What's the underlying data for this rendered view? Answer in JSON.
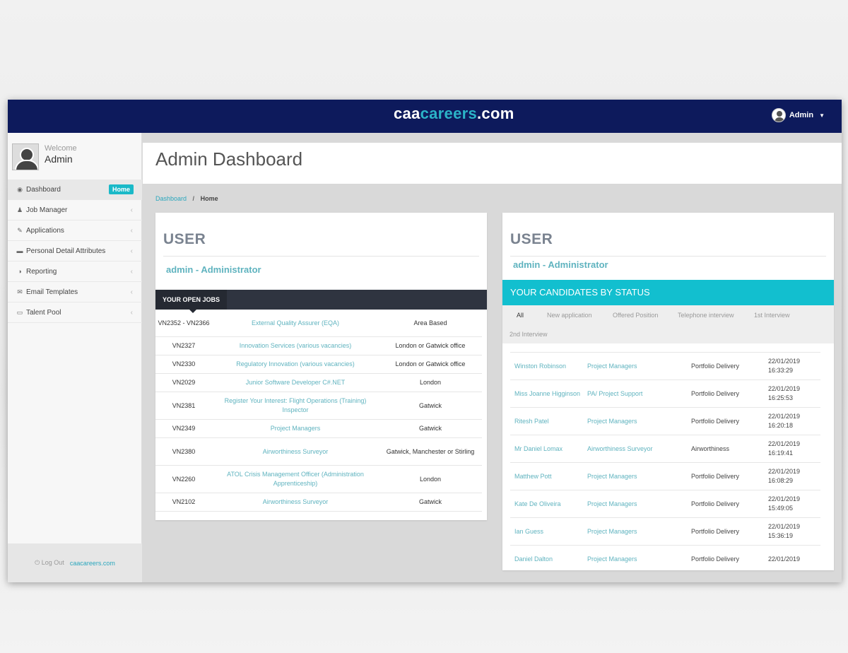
{
  "brand": {
    "prefix": "caa",
    "accent": "careers",
    "suffix": ".com"
  },
  "user_menu": {
    "name": "Admin"
  },
  "sidebar": {
    "welcome_label": "Welcome",
    "welcome_name": "Admin",
    "items": [
      {
        "label": "Dashboard",
        "icon": "dashboard-icon",
        "glyph": "◉",
        "badge": "Home"
      },
      {
        "label": "Job Manager",
        "icon": "user-icon",
        "glyph": "♟"
      },
      {
        "label": "Applications",
        "icon": "edit-icon",
        "glyph": "✎"
      },
      {
        "label": "Personal Detail Attributes",
        "icon": "folder-icon",
        "glyph": "▬"
      },
      {
        "label": "Reporting",
        "icon": "pie-chart-icon",
        "glyph": "◑"
      },
      {
        "label": "Email Templates",
        "icon": "envelope-icon",
        "glyph": "✉"
      },
      {
        "label": "Talent Pool",
        "icon": "inbox-icon",
        "glyph": "▭"
      }
    ],
    "logout": "⏻ Log Out",
    "footer_link": "caacareers.com"
  },
  "page": {
    "title": "Admin Dashboard"
  },
  "breadcrumb": {
    "link": "Dashboard",
    "separator": "/",
    "current": "Home"
  },
  "left_panel": {
    "heading": "USER",
    "role": "admin - Administrator",
    "jobs_tab": "YOUR OPEN JOBS",
    "jobs": [
      {
        "id": "VN2352 - VN2366",
        "title": "External Quality Assurer (EQA)",
        "location": "Area Based",
        "h": 39
      },
      {
        "id": "VN2327",
        "title": "Innovation Services (various vacancies)",
        "location": "London or Gatwick office",
        "h": 26
      },
      {
        "id": "VN2330",
        "title": "Regulatory Innovation (various vacancies)",
        "location": "London or Gatwick office",
        "h": 26
      },
      {
        "id": "VN2029",
        "title": "Junior Software Developer C#.NET",
        "location": "London",
        "h": 26
      },
      {
        "id": "VN2381",
        "title": "Register Your Interest: Flight Operations (Training) Inspector",
        "location": "Gatwick",
        "h": 39
      },
      {
        "id": "VN2349",
        "title": "Project Managers",
        "location": "Gatwick",
        "h": 26
      },
      {
        "id": "VN2380",
        "title": "Airworthiness Surveyor",
        "location": "Gatwick, Manchester or Stirling",
        "h": 39
      },
      {
        "id": "VN2260",
        "title": "ATOL Crisis Management Officer (Administration Apprenticeship)",
        "location": "London",
        "h": 39
      },
      {
        "id": "VN2102",
        "title": "Airworthiness Surveyor",
        "location": "Gatwick",
        "h": 26
      }
    ]
  },
  "right_panel": {
    "heading": "USER",
    "role": "admin - Administrator",
    "candidates_title": "YOUR CANDIDATES BY STATUS",
    "status_tabs": [
      "All",
      "New application",
      "Offered Position",
      "Telephone interview",
      "1st Interview",
      "2nd Interview"
    ],
    "candidates": [
      {
        "name": "Winston Robinson",
        "job": "Project Managers",
        "dept": "Portfolio Delivery",
        "date": "22/01/2019 16:33:29"
      },
      {
        "name": "Miss Joanne Higginson",
        "job": "PA/ Project Support",
        "dept": "Portfolio Delivery",
        "date": "22/01/2019 16:25:53"
      },
      {
        "name": "Ritesh Patel",
        "job": "Project Managers",
        "dept": "Portfolio Delivery",
        "date": "22/01/2019 16:20:18"
      },
      {
        "name": "Mr Daniel Lomax",
        "job": "Airworthiness Surveyor",
        "dept": "Airworthiness",
        "date": "22/01/2019 16:19:41"
      },
      {
        "name": "Matthew Pott",
        "job": "Project Managers",
        "dept": "Portfolio Delivery",
        "date": "22/01/2019 16:08:29"
      },
      {
        "name": "Kate De Oliveira",
        "job": "Project Managers",
        "dept": "Portfolio Delivery",
        "date": "22/01/2019 15:49:05"
      },
      {
        "name": "Ian Guess",
        "job": "Project Managers",
        "dept": "Portfolio Delivery",
        "date": "22/01/2019 15:36:19"
      },
      {
        "name": "Daniel Dalton",
        "job": "Project Managers",
        "dept": "Portfolio Delivery",
        "date": "22/01/2019"
      }
    ]
  },
  "colors": {
    "topbar": "#0d1a5c",
    "accent": "#12bfcf",
    "link": "#5fb3bf",
    "dark_bar": "#2f3440"
  }
}
